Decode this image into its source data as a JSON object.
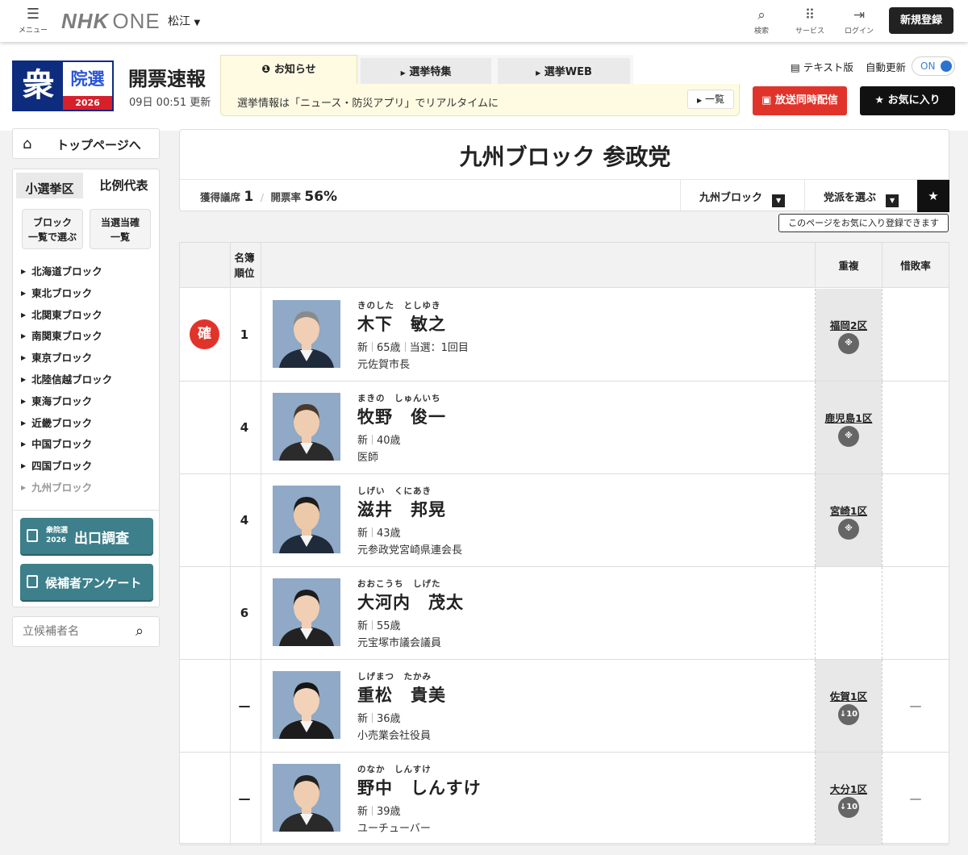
{
  "topbar": {
    "menu_label": "メニュー",
    "logo_nhk": "NHK",
    "logo_one": "ONE",
    "region": "松江",
    "search_label": "検索",
    "services_label": "サービス",
    "login_label": "ログイン",
    "signup_label": "新規登録"
  },
  "header": {
    "badge_main": "衆",
    "badge_sub": "院選",
    "badge_year": "2026",
    "title": "開票速報",
    "updated": "09日 00:51 更新",
    "notice_tab": "お知らせ",
    "tab_feature": "選挙特集",
    "tab_web": "選挙WEB",
    "notice_text": "選挙情報は「ニュース・防災アプリ」でリアルタイムに",
    "notice_list": "一覧",
    "text_version": "テキスト版",
    "auto_update": "自動更新",
    "toggle_state": "ON",
    "simulcast": "放送同時配信",
    "favorite": "お気に入り"
  },
  "sidebar": {
    "top_page": "トップページへ",
    "tab_district": "小選挙区",
    "tab_proportional": "比例代表",
    "btn_block_list": [
      "ブロック",
      "一覧で選ぶ"
    ],
    "btn_elected_list": [
      "当選当確",
      "一覧"
    ],
    "blocks": [
      "北海道ブロック",
      "東北ブロック",
      "北関東ブロック",
      "南関東ブロック",
      "東京ブロック",
      "北陸信越ブロック",
      "東海ブロック",
      "近畿ブロック",
      "中国ブロック",
      "四国ブロック",
      "九州ブロック"
    ],
    "exit_poll_small": [
      "衆院選",
      "2026"
    ],
    "exit_poll": "出口調査",
    "survey": "候補者アンケート",
    "search_placeholder": "立候補者名"
  },
  "main": {
    "title": "九州ブロック 参政党",
    "seats_label": "獲得議席",
    "seats_value": "1",
    "count_label": "開票率",
    "count_value": "56%",
    "dd_block": "九州ブロック",
    "dd_party": "党派を選ぶ",
    "tooltip": "このページをお気に入り登録できます"
  },
  "table": {
    "col_rank": [
      "名簿",
      "順位"
    ],
    "col_dup": "重複",
    "col_loss": "惜敗率",
    "rows": [
      {
        "status": "確",
        "rank": "1",
        "kana": "きのした　としゆき",
        "name": "木下　敏之",
        "info": [
          "新",
          "65歳",
          "当選：1回目"
        ],
        "job": "元佐賀市長",
        "dup": "福岡2区",
        "dup_mark": "※",
        "loss": ""
      },
      {
        "status": "",
        "rank": "4",
        "kana": "まきの　しゅんいち",
        "name": "牧野　俊一",
        "info": [
          "新",
          "40歳"
        ],
        "job": "医師",
        "dup": "鹿児島1区",
        "dup_mark": "※",
        "loss": ""
      },
      {
        "status": "",
        "rank": "4",
        "kana": "しげい　くにあき",
        "name": "滋井　邦晃",
        "info": [
          "新",
          "43歳"
        ],
        "job": "元参政党宮崎県連会長",
        "dup": "宮崎1区",
        "dup_mark": "※",
        "loss": ""
      },
      {
        "status": "",
        "rank": "6",
        "kana": "おおこうち　しげた",
        "name": "大河内　茂太",
        "info": [
          "新",
          "55歳"
        ],
        "job": "元宝塚市議会議員",
        "dup": "",
        "dup_mark": "",
        "loss": ""
      },
      {
        "status": "",
        "rank": "—",
        "kana": "しげまつ　たかみ",
        "name": "重松　貴美",
        "info": [
          "新",
          "36歳"
        ],
        "job": "小売業会社役員",
        "dup": "佐賀1区",
        "dup_mark": "↓10",
        "loss": "—"
      },
      {
        "status": "",
        "rank": "—",
        "kana": "のなか　しんすけ",
        "name": "野中　しんすけ",
        "info": [
          "新",
          "39歳"
        ],
        "job": "ユーチューバー",
        "dup": "大分1区",
        "dup_mark": "↓10",
        "loss": "—"
      }
    ]
  }
}
